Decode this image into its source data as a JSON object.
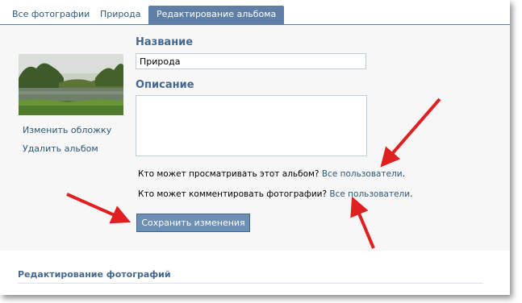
{
  "tabs": [
    {
      "label": "Все фотографии"
    },
    {
      "label": "Природа"
    },
    {
      "label": "Редактирование альбома"
    }
  ],
  "sidebar": {
    "change_cover": "Изменить обложку",
    "delete_album": "Удалить альбом"
  },
  "form": {
    "name_label": "Название",
    "name_value": "Природа",
    "description_label": "Описание",
    "description_value": "",
    "view_question": "Кто может просматривать этот альбом?",
    "view_value": "Все пользователи",
    "comment_question": "Кто может комментировать фотографии?",
    "comment_value": "Все пользователи",
    "period": ".",
    "save_label": "Сохранить изменения"
  },
  "section": {
    "title": "Редактирование фотографий"
  },
  "colors": {
    "accent": "#5f7fa7",
    "link": "#2b587a",
    "heading": "#45688e",
    "annotation_arrow": "#e02020"
  },
  "icons": [
    "annotation-arrow"
  ]
}
